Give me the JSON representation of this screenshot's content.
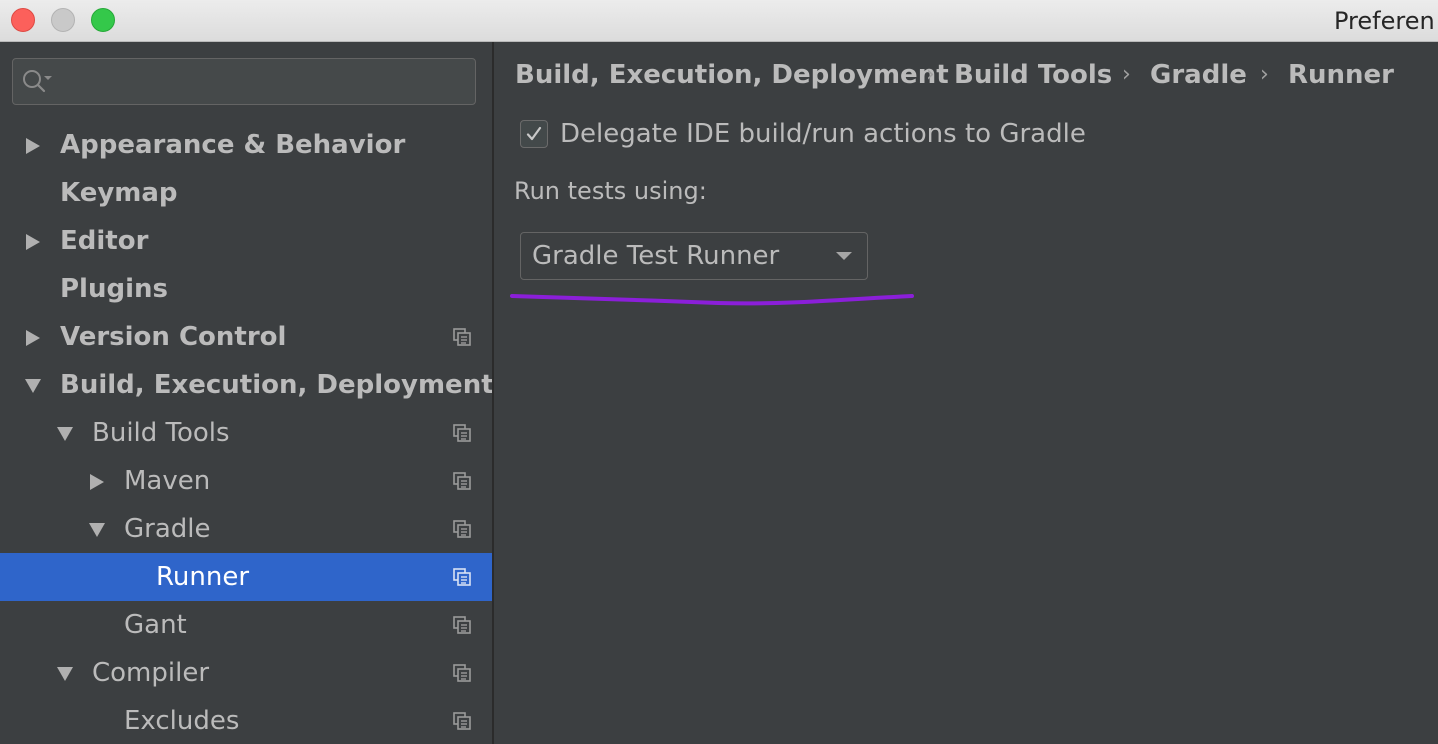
{
  "window": {
    "title": "Preferen"
  },
  "search": {
    "placeholder": ""
  },
  "tree": [
    {
      "label": "Appearance & Behavior",
      "bold": true,
      "arrow": "right",
      "copy_icon": false
    },
    {
      "label": "Keymap",
      "bold": true,
      "arrow": "none",
      "copy_icon": false
    },
    {
      "label": "Editor",
      "bold": true,
      "arrow": "right",
      "copy_icon": false
    },
    {
      "label": "Plugins",
      "bold": true,
      "arrow": "none",
      "copy_icon": false
    },
    {
      "label": "Version Control",
      "bold": true,
      "arrow": "right",
      "copy_icon": true
    },
    {
      "label": "Build, Execution, Deployment",
      "bold": true,
      "arrow": "down",
      "copy_icon": false
    },
    {
      "label": "Build Tools",
      "bold": false,
      "arrow": "down",
      "copy_icon": true
    },
    {
      "label": "Maven",
      "bold": false,
      "arrow": "right",
      "copy_icon": true
    },
    {
      "label": "Gradle",
      "bold": false,
      "arrow": "down",
      "copy_icon": true
    },
    {
      "label": "Runner",
      "bold": false,
      "arrow": "none",
      "copy_icon": true,
      "selected": true
    },
    {
      "label": "Gant",
      "bold": false,
      "arrow": "none",
      "copy_icon": true
    },
    {
      "label": "Compiler",
      "bold": false,
      "arrow": "down",
      "copy_icon": true
    },
    {
      "label": "Excludes",
      "bold": false,
      "arrow": "none",
      "copy_icon": true
    }
  ],
  "breadcrumb": [
    "Build, Execution, Deployment",
    "Build Tools",
    "Gradle",
    "Runner"
  ],
  "breadcrumb_separator": "›",
  "delegate": {
    "label": "Delegate IDE build/run actions to Gradle",
    "checked": true
  },
  "run_tests": {
    "label": "Run tests using:",
    "selected": "Gradle Test Runner"
  },
  "colors": {
    "background": "#3c3f41",
    "selection": "#2f65ca",
    "text": "#bbbbbb",
    "annotation": "#8b1fd9"
  }
}
